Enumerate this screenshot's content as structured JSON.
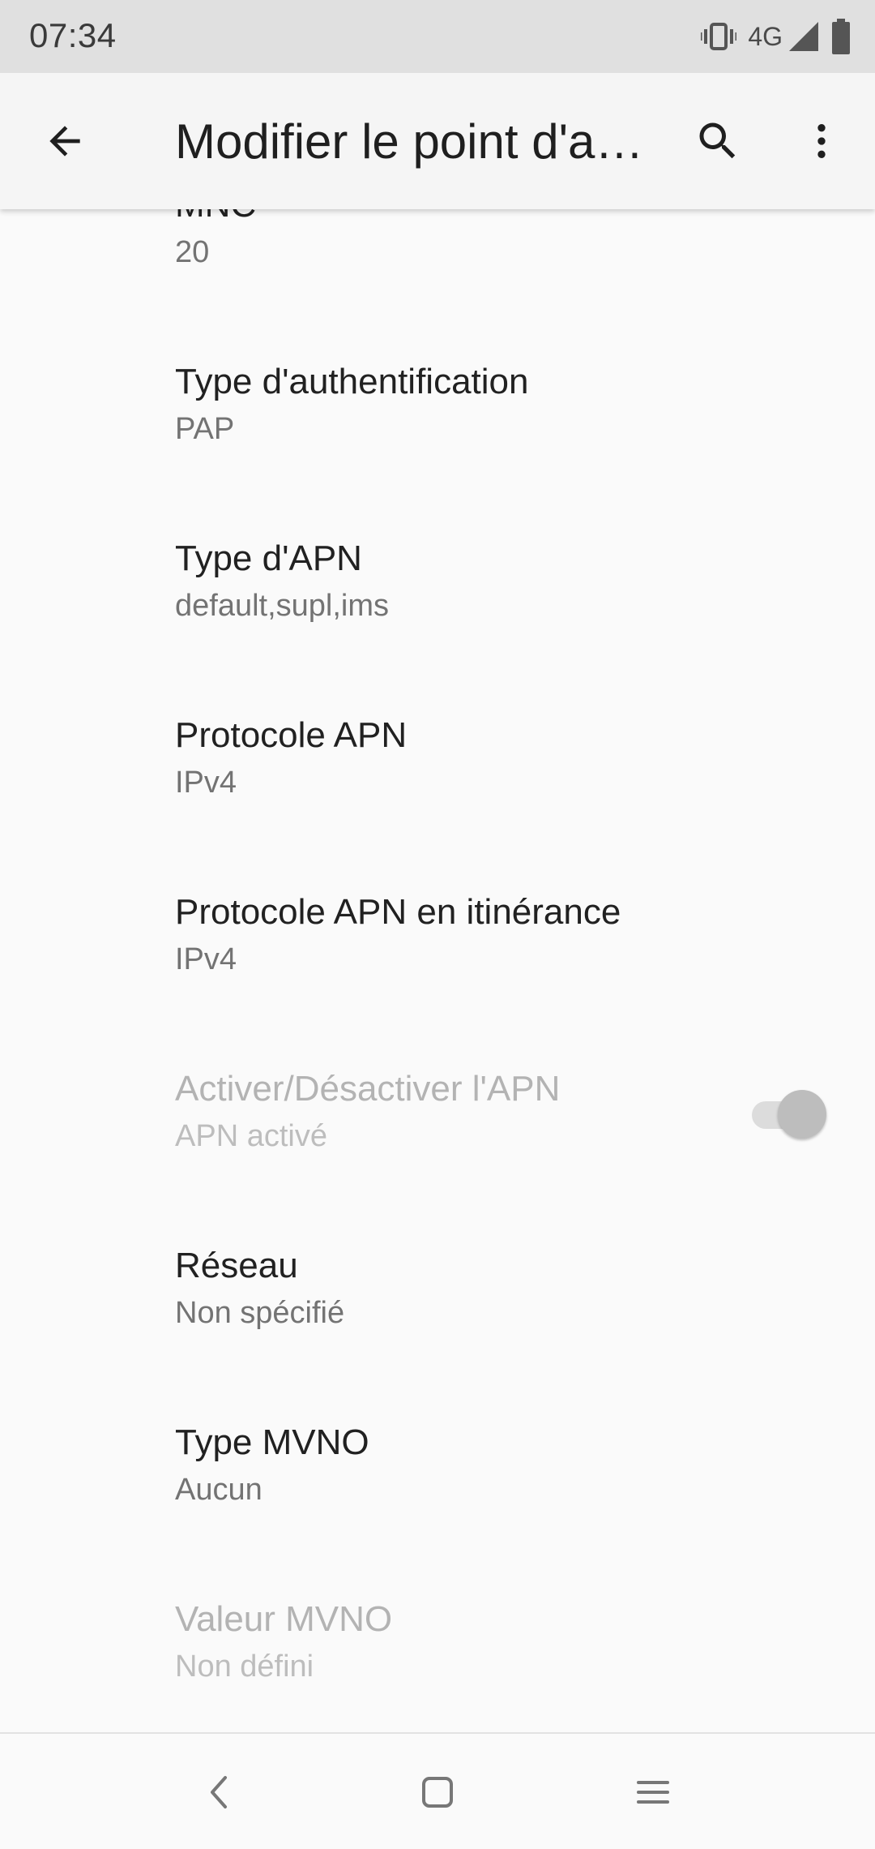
{
  "status_bar": {
    "time": "07:34",
    "network_type": "4G",
    "icons": [
      "vibrate-icon",
      "signal-icon",
      "battery-icon"
    ]
  },
  "toolbar": {
    "title": "Modifier le point d'accès",
    "back_icon": "arrow-back-icon",
    "search_icon": "search-icon",
    "more_icon": "more-vert-icon"
  },
  "preferences": [
    {
      "key": "mnc",
      "title": "MNC",
      "summary": "20",
      "enabled": true
    },
    {
      "key": "auth_type",
      "title": "Type d'authentification",
      "summary": "PAP",
      "enabled": true
    },
    {
      "key": "apn_type",
      "title": "Type d'APN",
      "summary": "default,supl,ims",
      "enabled": true
    },
    {
      "key": "apn_protocol",
      "title": "Protocole APN",
      "summary": "IPv4",
      "enabled": true
    },
    {
      "key": "apn_roaming_protocol",
      "title": "Protocole APN en itinérance",
      "summary": "IPv4",
      "enabled": true
    },
    {
      "key": "apn_enable",
      "title": "Activer/Désactiver l'APN",
      "summary": "APN activé",
      "enabled": false,
      "toggle_on": true
    },
    {
      "key": "bearer",
      "title": "Réseau",
      "summary": "Non spécifié",
      "enabled": true
    },
    {
      "key": "mvno_type",
      "title": "Type MVNO",
      "summary": "Aucun",
      "enabled": true
    },
    {
      "key": "mvno_value",
      "title": "Valeur MVNO",
      "summary": "Non défini",
      "enabled": false
    }
  ],
  "nav_bar": {
    "icons": [
      "nav-back-icon",
      "nav-home-icon",
      "nav-recents-icon"
    ]
  },
  "colors": {
    "status_bar_bg": "#e0e0e0",
    "toolbar_bg": "#f5f5f5",
    "page_bg": "#fafafa",
    "title_text": "#212121",
    "summary_text": "#737373",
    "disabled_text": "#b3b3b3"
  }
}
